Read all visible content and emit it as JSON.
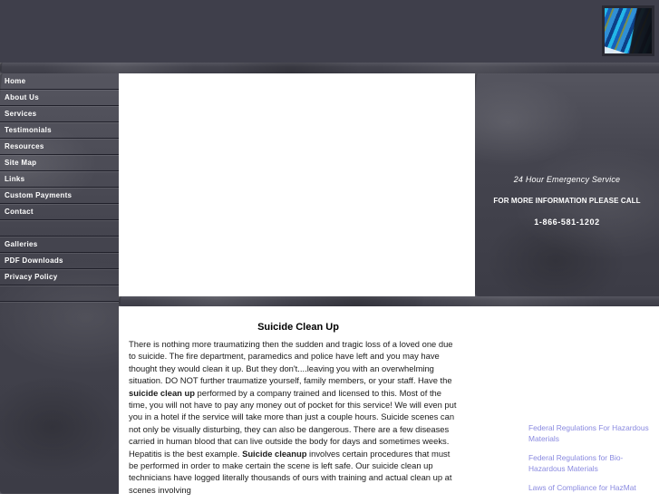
{
  "header": {
    "logo_alt": "abstract-blue-brushstroke-thumbnail"
  },
  "sidebar": {
    "items": [
      {
        "label": "Home"
      },
      {
        "label": "About Us"
      },
      {
        "label": "Services"
      },
      {
        "label": "Testimonials"
      },
      {
        "label": "Resources"
      },
      {
        "label": "Site Map"
      },
      {
        "label": "Links"
      },
      {
        "label": "Custom Payments"
      },
      {
        "label": "Contact"
      },
      {
        "label": "Galleries"
      },
      {
        "label": "PDF Downloads"
      },
      {
        "label": "Privacy Policy"
      }
    ]
  },
  "emergency": {
    "tagline": "24 Hour Emergency Service",
    "callout": "FOR MORE INFORMATION PLEASE CALL",
    "phone": "1-866-581-1202"
  },
  "article": {
    "title": "Suicide Clean Up",
    "para_1": "There is nothing more traumatizing then the sudden and tragic loss of a loved one due to suicide.  The fire department, paramedics and police have left and you may have thought they would clean it up. But they don't....leaving you with an overwhelming situation. DO NOT further traumatize yourself, family members, or your staff. Have the ",
    "bold_1": "suicide clean up",
    "para_2": " performed by a company trained and licensed to this. Most of the time, you will not have to pay any money out of pocket for this service! We will even put you in a hotel if the service will take more than just a couple hours. Suicide scenes can not only be visually disturbing, they can also be dangerous. There are a few diseases carried in human blood that can live outside the body for days and sometimes weeks. Hepatitis is the best example. ",
    "bold_2": "Suicide cleanup",
    "para_3": " involves certain procedures that must be performed in order to make certain the scene is left safe. Our suicide clean up technicians have logged literally thousands of ours with training and actual clean up at scenes involving"
  },
  "resources": {
    "links": [
      {
        "label": "Federal Regulations For Hazardous Materials"
      },
      {
        "label": "Federal Regulations for Bio-Hazardous Materials"
      },
      {
        "label": "Laws of Compliance for HazMat"
      }
    ],
    "link_color": "#8a8ae0"
  },
  "theme": {
    "header_band": "#3f3f4b",
    "stone_base": "#4a4a55",
    "nav_text": "#ffffff",
    "body_text": "#1a1a1a"
  }
}
